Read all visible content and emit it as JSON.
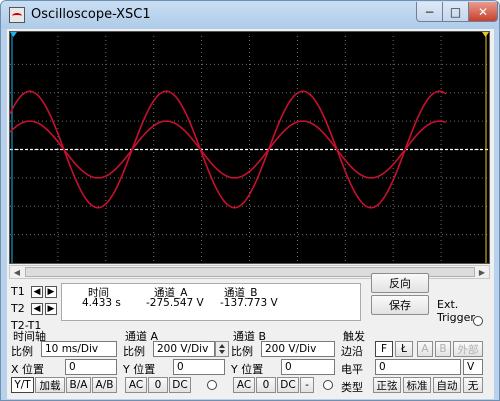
{
  "window": {
    "title": "Oscilloscope-XSC1",
    "minimize_glyph": "−",
    "maximize_glyph": "□",
    "close_glyph": "✕"
  },
  "colors": {
    "screen_bg": "#000000",
    "grid": "#6e6e6e",
    "trace_a": "#c8102e",
    "trace_b": "#c8102e",
    "baseline": "#ffffff",
    "cursor_t1": "#1eb4e6",
    "cursor_t2": "#e6c81e"
  },
  "chart_data": {
    "type": "line",
    "x_unit": "ms",
    "x_range": [
      0,
      100
    ],
    "grid_divisions": {
      "horizontal": 10,
      "vertical": 8
    },
    "series": [
      {
        "name": "通道_A",
        "amplitude_div": 2.05,
        "period_ms": 28.5,
        "phase_offset_ms": -3,
        "time_range_ms": [
          0,
          91
        ]
      },
      {
        "name": "通道_B",
        "amplitude_div": 1.0,
        "period_ms": 28.5,
        "phase_offset_ms": -3,
        "time_range_ms": [
          0,
          91
        ]
      }
    ]
  },
  "cursors": {
    "t1_label": "T1",
    "t2_label": "T2",
    "t2t1_label": "T2-T1",
    "left_arrow": "◀",
    "right_arrow": "▶"
  },
  "readout": {
    "col_time": "时间",
    "col_a": "通道_A",
    "col_b": "通道_B",
    "time_value": "4.433 s",
    "a_value": "-275.547 V",
    "b_value": "-137.773 V"
  },
  "buttons": {
    "reverse": "反向",
    "save": "保存",
    "ext_trigger": "Ext. Trigger"
  },
  "timebase": {
    "title": "时间轴",
    "scale_label": "比例",
    "scale_value": "10 ms/Div",
    "xpos_label": "X 位置",
    "xpos_value": "0",
    "mode_yt": "Y/T",
    "mode_add": "加载",
    "mode_ba": "B/A",
    "mode_ab": "A/B"
  },
  "channel_a": {
    "title": "通道 A",
    "scale_label": "比例",
    "scale_value": "200  V/Div",
    "ypos_label": "Y 位置",
    "ypos_value": "0",
    "ac": "AC",
    "zero": "0",
    "dc": "DC"
  },
  "channel_b": {
    "title": "通道 B",
    "scale_label": "比例",
    "scale_value": "200  V/Div",
    "ypos_label": "Y 位置",
    "ypos_value": "0",
    "ac": "AC",
    "zero": "0",
    "dc": "DC",
    "minus": "-"
  },
  "trigger": {
    "title": "触发",
    "edge_label": "边沿",
    "level_label": "电平",
    "type_label": "类型",
    "rise_glyph": "F",
    "fall_glyph": "Ł",
    "a": "A",
    "b": "B",
    "ext": "外部",
    "level_value": "0",
    "unit": "V",
    "sine": "正弦",
    "standard": "标准",
    "auto": "自动",
    "none": "无"
  }
}
